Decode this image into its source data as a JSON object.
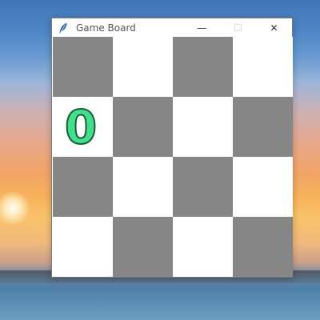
{
  "window": {
    "title": "Game Board",
    "icon": "feather-icon",
    "controls": {
      "minimize": "—",
      "maximize": "☐",
      "close": "✕"
    }
  },
  "board": {
    "rows": 4,
    "cols": 4,
    "colors": {
      "dark": "#868686",
      "light": "#ffffff"
    },
    "cells": [
      [
        "dark",
        "light",
        "dark",
        "light"
      ],
      [
        "light",
        "dark",
        "light",
        "dark"
      ],
      [
        "dark",
        "light",
        "dark",
        "light"
      ],
      [
        "light",
        "dark",
        "light",
        "dark"
      ]
    ],
    "pieces": [
      {
        "row": 1,
        "col": 0,
        "label": "0",
        "fill": "#3fe08a",
        "stroke": "#1e5a3a"
      }
    ]
  }
}
